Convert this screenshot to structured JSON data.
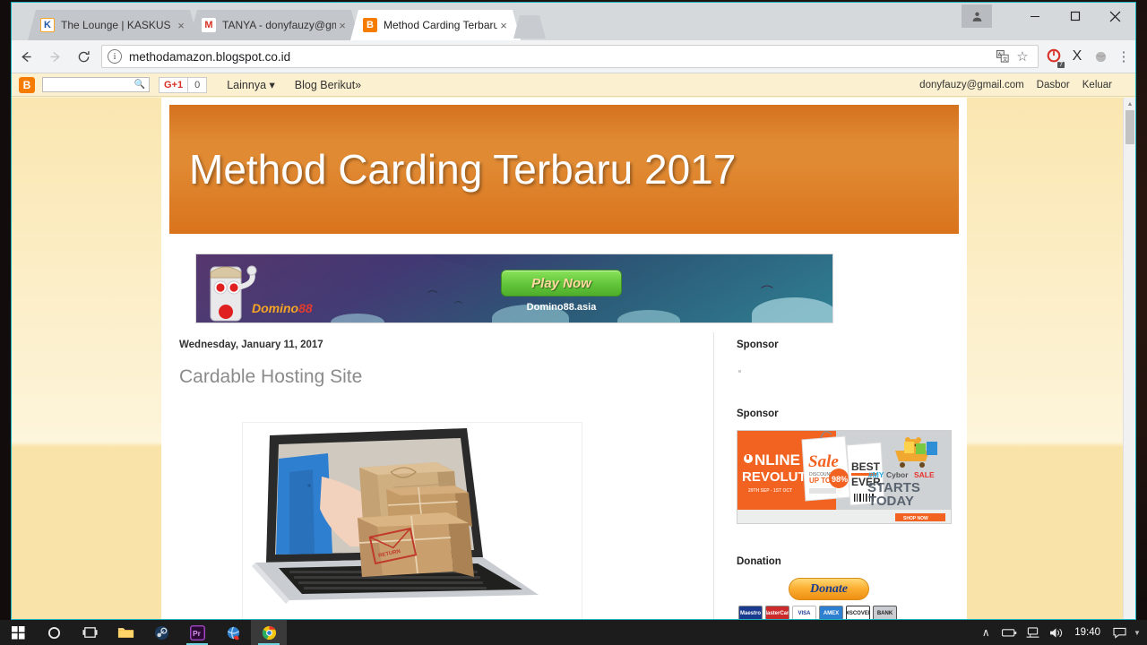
{
  "browser": {
    "tabs": [
      {
        "title": "The Lounge | KASKUS",
        "favicon": "kaskus-icon",
        "fav_text": "K",
        "close": "×",
        "active": false
      },
      {
        "title": "TANYA - donyfauzy@gm",
        "favicon": "gmail-icon",
        "fav_text": "M",
        "close": "×",
        "active": false
      },
      {
        "title": "Method Carding Terbaru",
        "favicon": "blogger-icon",
        "fav_text": "B",
        "close": "×",
        "active": true
      }
    ],
    "new_tab_label": "",
    "window_controls": {
      "minimize": "–",
      "maximize": "☐",
      "close": "✕",
      "profile": "὆4"
    },
    "toolbar": {
      "back": "←",
      "forward": "→",
      "reload": "⟳",
      "site_info": "i",
      "url": "methodamazon.blogspot.co.id",
      "translate_icon": "translate-icon",
      "bookmark_icon": "☆",
      "extensions": [
        {
          "name": "adblock-icon",
          "badge": "7"
        },
        {
          "name": "x-extension-icon",
          "glyph": "X"
        },
        {
          "name": "globe-extension-icon",
          "glyph": "●"
        }
      ],
      "menu_icon": "⋮"
    }
  },
  "blogger_navbar": {
    "logo": "B",
    "search_placeholder": "",
    "search_icon": "🔍",
    "gplus_label": "G+1",
    "gplus_count": "0",
    "links": [
      "Lainnya ▾",
      "Blog Berikut»"
    ],
    "account_email": "donyfauzy@gmail.com",
    "dashboard_label": "Dasbor",
    "logout_label": "Keluar"
  },
  "page": {
    "header_title": "Method Carding Terbaru 2017",
    "ad_banner": {
      "button_label": "Play Now",
      "domain": "Domino88.asia",
      "brand_part1": "Domino",
      "brand_part2": "88"
    },
    "post": {
      "date": "Wednesday, January 11, 2017",
      "title": "Cardable Hosting Site",
      "image_alt": "laptop-with-parcels-image"
    },
    "sidebar": {
      "sponsor_1_label": "Sponsor",
      "sponsor_2_label": "Sponsor",
      "sponsor_ad": {
        "line1": "ONLINE",
        "line2": "REVOLUTION",
        "line3": "29TH SEP - 1ST OCT",
        "sale": "Sale",
        "discount_top": "UP TO",
        "discount": "98%",
        "best": "BEST",
        "ever": "EVER",
        "hashtag_a": "#MY",
        "hashtag_b": "Cybor",
        "hashtag_c": "SALE",
        "starts": "STARTS",
        "today": "TODAY",
        "shop_now": "SHOP NOW"
      },
      "donation_label": "Donation",
      "donate_button": "Donate",
      "cards": [
        "Maestro",
        "MasterCard",
        "VISA",
        "AMEX",
        "DISCOVER",
        "BANK"
      ]
    }
  },
  "taskbar": {
    "items": [
      {
        "name": "start-button",
        "glyph": "⊞"
      },
      {
        "name": "cortana-search-icon",
        "glyph": "○"
      },
      {
        "name": "task-view-icon",
        "glyph": "❐"
      },
      {
        "name": "file-explorer-icon",
        "glyph": "🗀"
      },
      {
        "name": "steam-icon",
        "glyph": "◉"
      },
      {
        "name": "premiere-pro-icon",
        "glyph": "Pr"
      },
      {
        "name": "internet-explorer-icon",
        "glyph": "e"
      },
      {
        "name": "chrome-icon",
        "glyph": "●"
      }
    ],
    "tray": {
      "chevron": "∧",
      "battery": "▭",
      "network": "🖧",
      "volume": "🔊",
      "clock": "19:40",
      "notification": "💬"
    }
  },
  "colors": {
    "accent_orange": "#e08a33",
    "page_bg": "#fae6b0",
    "chrome_frame": "#d6d9dc",
    "tab_active": "#ffffff",
    "taskbar": "#1c1c1c"
  }
}
